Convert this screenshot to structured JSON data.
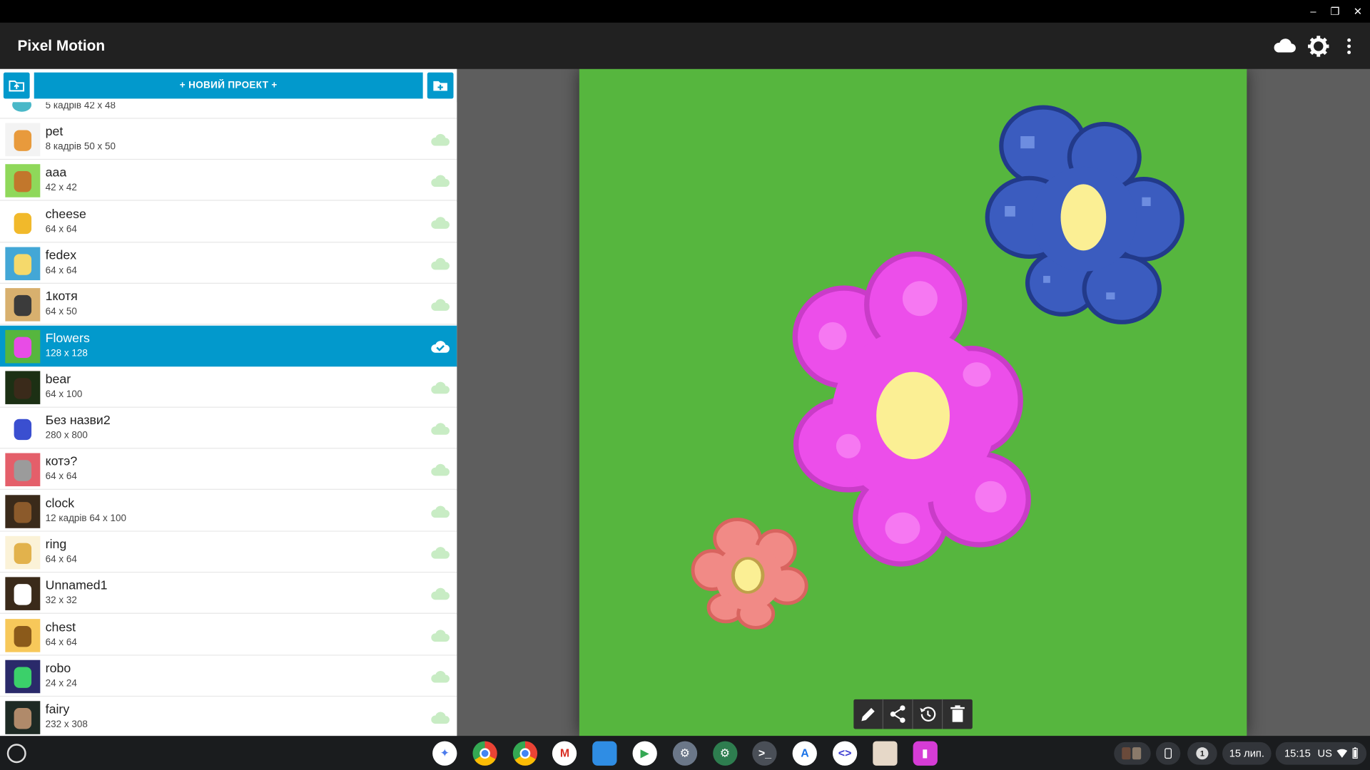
{
  "app": {
    "title": "Pixel Motion",
    "icons": {
      "cloud": "cloud-icon",
      "settings": "gear-icon",
      "menu": "more-vert-icon"
    }
  },
  "window": {
    "controls": [
      "minimize-icon",
      "restore-icon",
      "close-icon"
    ]
  },
  "sidebar": {
    "new_project_label": "+ НОВИЙ ПРОЕКТ +",
    "partial_item": {
      "sub": "5 кадрів 42 x 48"
    },
    "items": [
      {
        "name": "pet",
        "sub": "8 кадрів 50 x 50"
      },
      {
        "name": "aaa",
        "sub": "42 x 42"
      },
      {
        "name": "cheese",
        "sub": "64 x 64"
      },
      {
        "name": "fedex",
        "sub": "64 x 64"
      },
      {
        "name": "1котя",
        "sub": "64 x 50"
      },
      {
        "name": "Flowers",
        "sub": "128 x 128",
        "selected": true
      },
      {
        "name": "bear",
        "sub": "64 x 100"
      },
      {
        "name": "Без назви2",
        "sub": "280 x 800"
      },
      {
        "name": "котэ?",
        "sub": "64 x 64"
      },
      {
        "name": "clock",
        "sub": "12 кадрів 64 x 100"
      },
      {
        "name": "ring",
        "sub": "64 x 64"
      },
      {
        "name": "Unnamed1",
        "sub": "32 x 32"
      },
      {
        "name": "chest",
        "sub": "64 x 64"
      },
      {
        "name": "robo",
        "sub": "24 x 24"
      },
      {
        "name": "fairy",
        "sub": "232 x 308"
      }
    ]
  },
  "colors": {
    "accent": "#0299cc",
    "canvas_bg": "#56b63e",
    "cloud_unsynced": "#c8ecc4",
    "blue_flower": "#3a5bbf",
    "pink_flower": "#e84ce6",
    "salmon_flower": "#f08a86",
    "flower_center": "#fdf08f"
  },
  "canvas_tools": [
    "pencil-icon",
    "share-icon",
    "history-icon",
    "delete-icon"
  ],
  "taskbar": {
    "date": "15 лип.",
    "time": "15:15",
    "locale": "US",
    "notification_count": "1",
    "apps": [
      "gemini-icon",
      "chrome-icon",
      "chrome-icon",
      "gmail-icon",
      "files-icon",
      "play-store-icon",
      "settings-icon",
      "settings-icon",
      "terminal-icon",
      "app-store-icon",
      "code-icon",
      "gallery-icon",
      "pixel-motion-icon"
    ]
  }
}
